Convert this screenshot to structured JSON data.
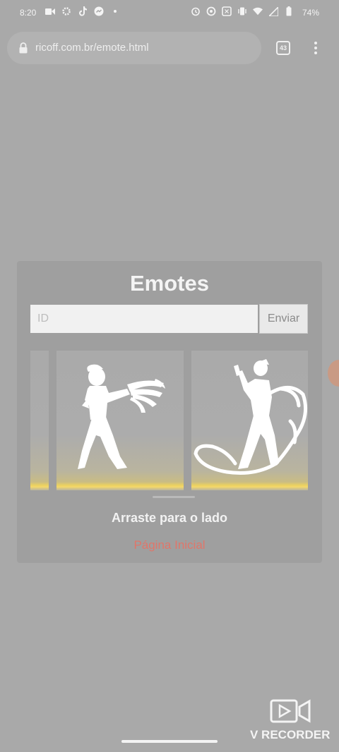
{
  "status_bar": {
    "time": "8:20",
    "battery": "74%"
  },
  "browser": {
    "url": "ricoff.com.br/emote.html",
    "tab_count": "43"
  },
  "page": {
    "title": "Emotes",
    "id_placeholder": "ID",
    "send_label": "Enviar",
    "drag_hint": "Arraste para o lado",
    "home_link": "Página Inicial"
  },
  "watermark": {
    "label": "V RECORDER"
  },
  "colors": {
    "background": "#a9a9a9",
    "link": "#e0766a",
    "glow": "#f4d86a"
  }
}
